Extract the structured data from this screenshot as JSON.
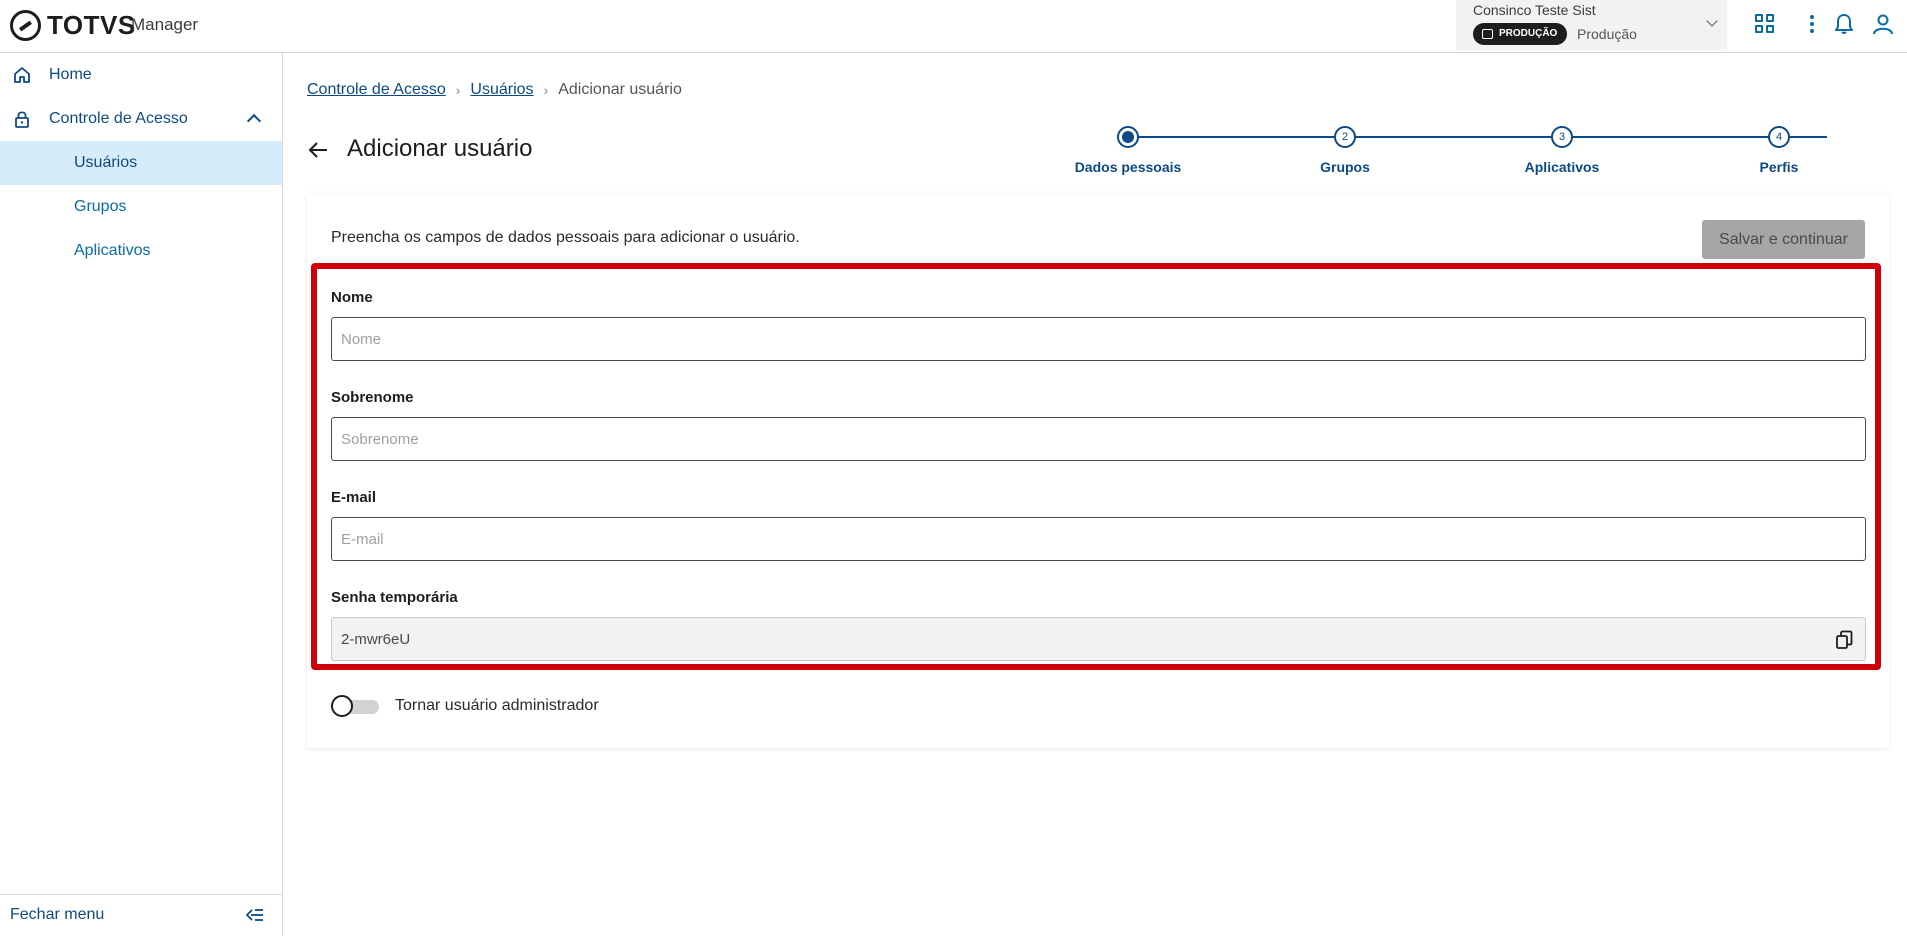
{
  "header": {
    "logo_text": "TOTVS",
    "app_name": "Manager",
    "environment": {
      "company": "Consinco Teste Sist",
      "badge": "PRODUÇÃO",
      "value": "Produção"
    }
  },
  "sidebar": {
    "items": [
      {
        "label": "Home",
        "icon": "home-icon"
      },
      {
        "label": "Controle de Acesso",
        "icon": "lock-icon",
        "expanded": true
      },
      {
        "label": "Usuários",
        "active": true
      },
      {
        "label": "Grupos"
      },
      {
        "label": "Aplicativos"
      }
    ],
    "footer_label": "Fechar menu"
  },
  "breadcrumb": {
    "items": [
      "Controle de Acesso",
      "Usuários"
    ],
    "current": "Adicionar usuário"
  },
  "page": {
    "title": "Adicionar usuário"
  },
  "stepper": {
    "steps": [
      {
        "number": "",
        "label": "Dados pessoais",
        "state": "current"
      },
      {
        "number": "2",
        "label": "Grupos",
        "state": "pending"
      },
      {
        "number": "3",
        "label": "Aplicativos",
        "state": "pending"
      },
      {
        "number": "4",
        "label": "Perfis",
        "state": "pending"
      }
    ]
  },
  "form": {
    "intro": "Preencha os campos de dados pessoais para adicionar o usuário.",
    "save_label": "Salvar e continuar",
    "fields": {
      "nome": {
        "label": "Nome",
        "placeholder": "Nome",
        "value": ""
      },
      "sobrenome": {
        "label": "Sobrenome",
        "placeholder": "Sobrenome",
        "value": ""
      },
      "email": {
        "label": "E-mail",
        "placeholder": "E-mail",
        "value": ""
      },
      "senha": {
        "label": "Senha temporária",
        "value": "2-mwr6eU"
      }
    },
    "admin_toggle_label": "Tornar usuário administrador",
    "admin_toggle_on": false
  },
  "colors": {
    "primary": "#0c4a85",
    "highlight": "#d0000a",
    "active_nav": "#d6ecf8"
  }
}
